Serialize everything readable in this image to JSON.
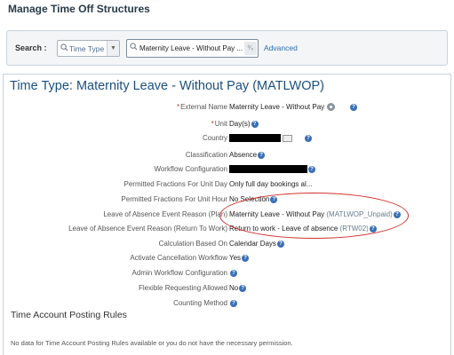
{
  "header": {
    "title": "Manage Time Off Structures"
  },
  "search": {
    "label": "Search :",
    "type_value": "Time Type",
    "text_value": "Maternity Leave - Without Pay ...",
    "advanced_label": "Advanced"
  },
  "record": {
    "title": "Time Type: Maternity Leave - Without Pay (MATLWOP)",
    "fields": {
      "external_name": {
        "label": "External Name",
        "value": "Maternity Leave - Without Pay"
      },
      "unit": {
        "label": "Unit",
        "value": "Day(s)"
      },
      "country": {
        "label": "Country",
        "value": ""
      },
      "classification": {
        "label": "Classification",
        "value": "Absence"
      },
      "workflow_configuration": {
        "label": "Workflow Configuration",
        "value": ""
      },
      "fractions_unit_day": {
        "label": "Permitted Fractions For Unit Day",
        "value": "Only full day bookings al..."
      },
      "fractions_unit_hour": {
        "label": "Permitted Fractions For Unit Hour",
        "value": "No Selection"
      },
      "loa_plan": {
        "label": "Leave of Absence Event Reason (Plan)",
        "value": "Maternity Leave - Without Pay",
        "code": "(MATLWOP_Unpaid)"
      },
      "loa_return": {
        "label": "Leave of Absence Event Reason (Return To Work)",
        "value": "Return to work - Leave of absence",
        "code": "(RTW02)"
      },
      "calculation_based_on": {
        "label": "Calculation Based On",
        "value": "Calendar Days"
      },
      "activate_cancellation": {
        "label": "Activate Cancellation Workflow",
        "value": "Yes"
      },
      "admin_workflow": {
        "label": "Admin Workflow Configuration",
        "value": ""
      },
      "flexible_requesting": {
        "label": "Flexible Requesting Allowed",
        "value": "No"
      },
      "counting_method": {
        "label": "Counting Method",
        "value": ""
      }
    }
  },
  "posting_rules": {
    "title": "Time Account Posting Rules",
    "empty_message": "No data for Time Account Posting Rules available or you do not have the necessary permission."
  },
  "colors": {
    "title_blue": "#1b4f7e",
    "help_blue": "#3b6fb6",
    "annotation_red": "#d0312d"
  },
  "icons": {
    "help": "help-icon",
    "settings": "gear-icon",
    "search": "search-icon"
  }
}
